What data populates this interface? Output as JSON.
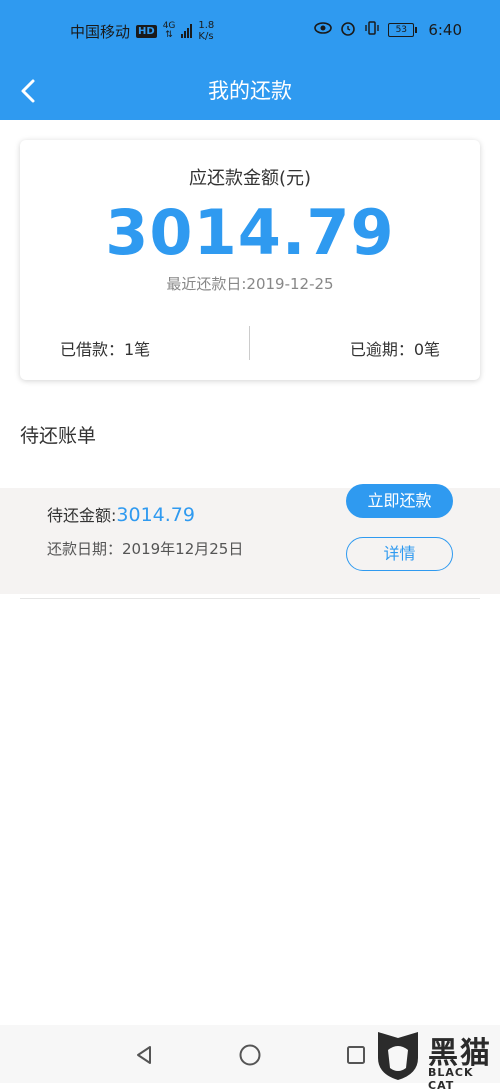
{
  "status_bar": {
    "carrier": "中国移动",
    "hd": "HD",
    "network": "4G",
    "speed_value": "1.8",
    "speed_unit": "K/s",
    "battery": "53",
    "time": "6:40"
  },
  "header": {
    "title": "我的还款"
  },
  "summary": {
    "label": "应还款金额(元)",
    "amount": "3014.79",
    "latest_due": "最近还款日:2019-12-25",
    "borrowed": "已借款：1笔",
    "overdue": "已逾期：0笔"
  },
  "section": {
    "title": "待还账单"
  },
  "bill": {
    "pending_label": "待还金额:",
    "pending_amount": "3014.79",
    "due_date": "还款日期：2019年12月25日",
    "pay_label": "立即还款",
    "detail_label": "详情"
  },
  "logo": {
    "cn": "黑猫",
    "en": "BLACK CAT"
  },
  "colors": {
    "accent": "#2f9af0",
    "background": "#ffffff"
  }
}
